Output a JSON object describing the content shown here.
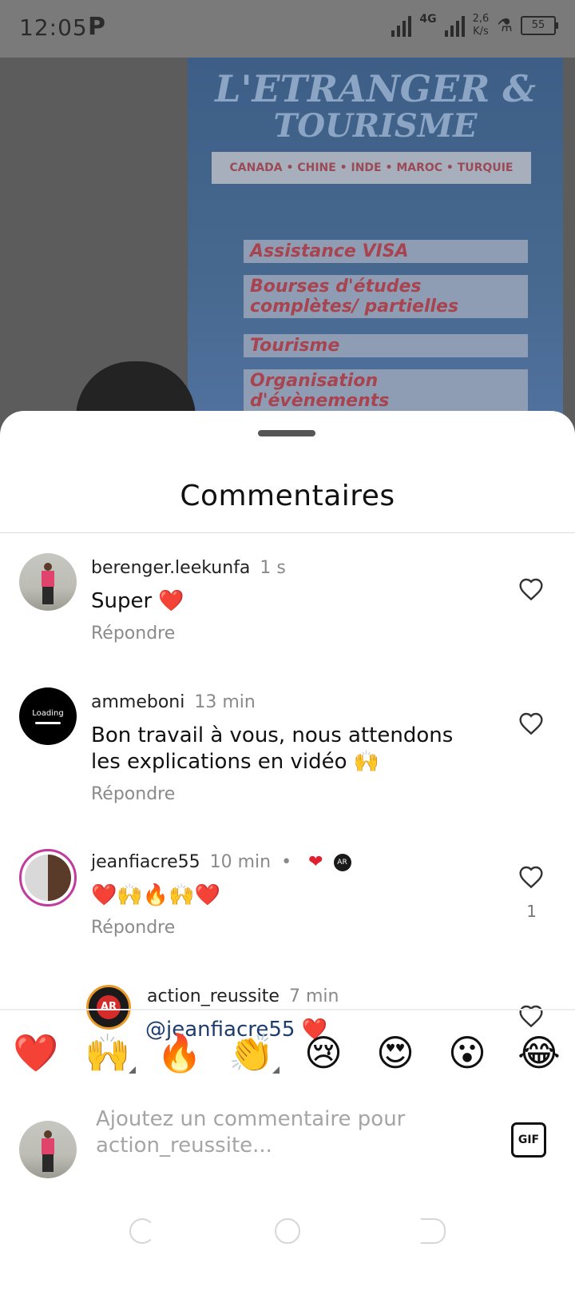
{
  "status_bar": {
    "time": "12:05",
    "app_icon": "P",
    "network": "4G",
    "speed_value": "2,6",
    "speed_unit": "K/s",
    "battery": "55"
  },
  "video": {
    "banner_line1": "L'ETRANGER &",
    "banner_line2": "TOURISME",
    "countries": "CANADA • CHINE • INDE • MAROC • TURQUIE",
    "services": [
      "Assistance VISA",
      "Bourses d'études complètes/ partielles",
      "Tourisme",
      "Organisation d'évènements"
    ]
  },
  "sheet": {
    "title": "Commentaires"
  },
  "comments": [
    {
      "username": "berenger.leekunfa",
      "time": "1 s",
      "text": "Super ❤️",
      "reply": "Répondre"
    },
    {
      "username": "ammeboni",
      "avatar_text": "Loading",
      "time": "13 min",
      "text": "Bon travail à vous, nous attendons les explications en vidéo 🙌",
      "reply": "Répondre"
    },
    {
      "username": "jeanfiacre55",
      "time": "10 min",
      "separator": "•",
      "liked_by_creator": "❤",
      "text": "❤️🙌🔥🙌❤️",
      "reply": "Répondre",
      "like_count": "1"
    },
    {
      "username": "action_reussite",
      "avatar_text": "AR",
      "time": "7 min",
      "mention": "@jeanfiacre55",
      "text": "❤️"
    }
  ],
  "emoji_bar": [
    "❤️",
    "🙌",
    "🔥",
    "👏",
    "😢",
    "😍",
    "😮",
    "😂"
  ],
  "composer": {
    "placeholder": "Ajoutez un commentaire pour action_reussite...",
    "gif_label": "GIF"
  }
}
